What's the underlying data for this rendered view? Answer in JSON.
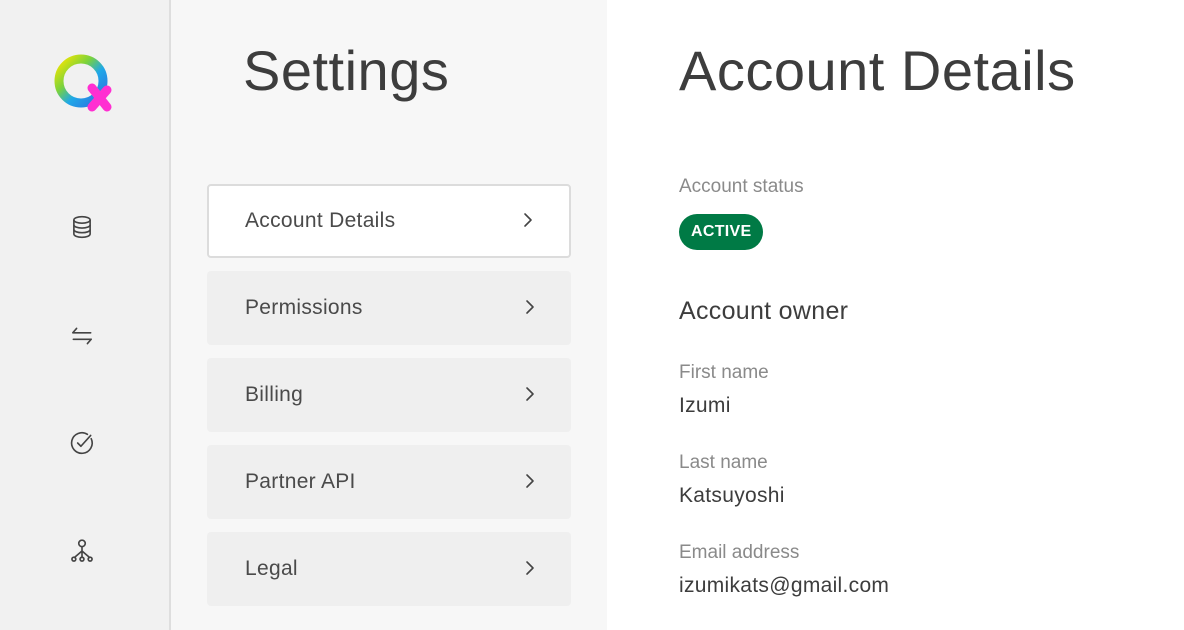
{
  "rail": {
    "items": [
      {
        "icon": "database-icon"
      },
      {
        "icon": "arrows-swap-icon"
      },
      {
        "icon": "check-circle-icon"
      },
      {
        "icon": "network-user-icon"
      }
    ]
  },
  "settings": {
    "title": "Settings",
    "items": [
      {
        "label": "Account Details",
        "active": true
      },
      {
        "label": "Permissions",
        "active": false
      },
      {
        "label": "Billing",
        "active": false
      },
      {
        "label": "Partner API",
        "active": false
      },
      {
        "label": "Legal",
        "active": false
      }
    ]
  },
  "detail": {
    "title": "Account Details",
    "status_label": "Account status",
    "status_value": "ACTIVE",
    "owner_heading": "Account owner",
    "first_name_label": "First name",
    "first_name": "Izumi",
    "last_name_label": "Last name",
    "last_name": "Katsuyoshi",
    "email_label": "Email address",
    "email": "izumikats@gmail.com"
  },
  "colors": {
    "status_active": "#007a45",
    "rail_bg": "#f1f1f1",
    "nav_bg": "#f7f7f7"
  }
}
